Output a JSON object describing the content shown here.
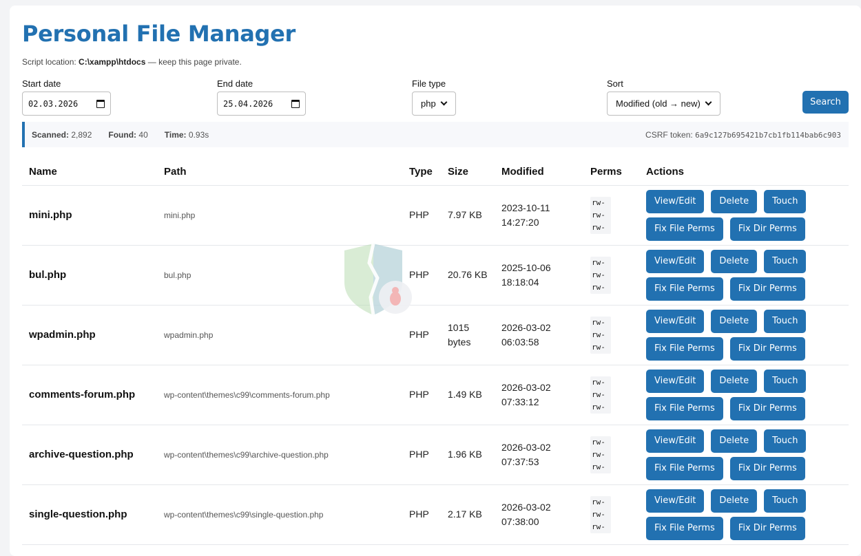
{
  "header": {
    "title": "Personal File Manager",
    "location_prefix": "Script location:",
    "location_path": "C:\\xampp\\htdocs",
    "location_suffix": "— keep this page private."
  },
  "filters": {
    "start_label": "Start date",
    "start_value": "02.03.2026",
    "end_label": "End date",
    "end_value": "25.04.2026",
    "type_label": "File type",
    "type_value": "php",
    "sort_label": "Sort",
    "sort_value": "Modified (old → new)",
    "search_label": "Search"
  },
  "stats": {
    "scanned_label": "Scanned:",
    "scanned_value": "2,892",
    "found_label": "Found:",
    "found_value": "40",
    "time_label": "Time:",
    "time_value": "0.93s",
    "csrf_label": "CSRF token:",
    "csrf_value": "6a9c127b695421b7cb1fb114bab6c903"
  },
  "table": {
    "headers": [
      "Name",
      "Path",
      "Type",
      "Size",
      "Modified",
      "Perms",
      "Actions"
    ],
    "action_labels": [
      "View/Edit",
      "Delete",
      "Touch",
      "Fix File Perms",
      "Fix Dir Perms"
    ],
    "rows": [
      {
        "name": "mini.php",
        "path": "mini.php",
        "type": "PHP",
        "size": "7.97 KB",
        "date": "2023-10-11",
        "time": "14:27:20",
        "perms": "rw-rw-rw-"
      },
      {
        "name": "bul.php",
        "path": "bul.php",
        "type": "PHP",
        "size": "20.76 KB",
        "date": "2025-10-06",
        "time": "18:18:04",
        "perms": "rw-rw-rw-"
      },
      {
        "name": "wpadmin.php",
        "path": "wpadmin.php",
        "type": "PHP",
        "size": "1015 bytes",
        "date": "2026-03-02",
        "time": "06:03:58",
        "perms": "rw-rw-rw-"
      },
      {
        "name": "comments-forum.php",
        "path": "wp-content\\themes\\c99\\comments-forum.php",
        "type": "PHP",
        "size": "1.49 KB",
        "date": "2026-03-02",
        "time": "07:33:12",
        "perms": "rw-rw-rw-"
      },
      {
        "name": "archive-question.php",
        "path": "wp-content\\themes\\c99\\archive-question.php",
        "type": "PHP",
        "size": "1.96 KB",
        "date": "2026-03-02",
        "time": "07:37:53",
        "perms": "rw-rw-rw-"
      },
      {
        "name": "single-question.php",
        "path": "wp-content\\themes\\c99\\single-question.php",
        "type": "PHP",
        "size": "2.17 KB",
        "date": "2026-03-02",
        "time": "07:38:00",
        "perms": "rw-rw-rw-"
      }
    ]
  },
  "colors": {
    "accent": "#2271b1",
    "background": "#f3f4f6"
  },
  "icons": {
    "calendar": "calendar-icon",
    "dropdown": "chevron-down-icon",
    "watermark": "shield-bug-icon"
  }
}
